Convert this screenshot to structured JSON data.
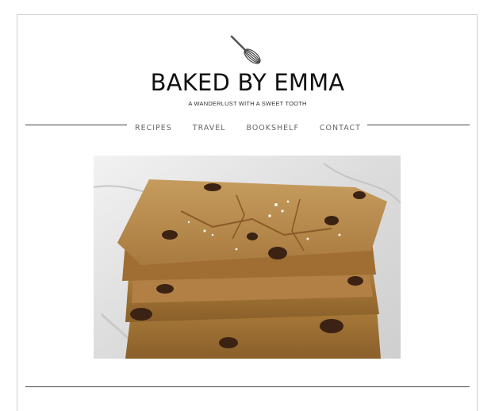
{
  "site": {
    "title": "BAKED BY EMMA",
    "tagline": "A WANDERLUST WITH A SWEET TOOTH",
    "logo_icon": "whisk-icon"
  },
  "nav": {
    "items": [
      {
        "label": "RECIPES"
      },
      {
        "label": "TRAVEL"
      },
      {
        "label": "BOOKSHELF"
      },
      {
        "label": "CONTACT"
      }
    ]
  },
  "hero": {
    "subject": "stacked blondie bars with chocolate chunks and flaky salt"
  },
  "colors": {
    "text": "#111111",
    "nav_text": "#666666",
    "rule": "#444444",
    "frame": "#cfcfcf"
  }
}
